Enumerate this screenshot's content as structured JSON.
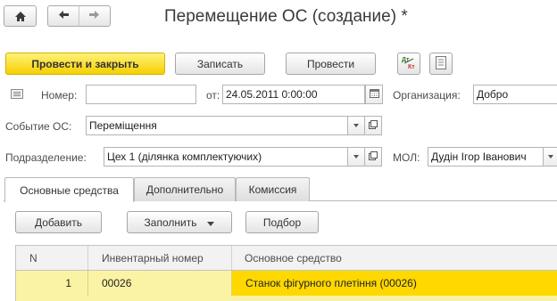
{
  "header": {
    "title": "Перемещение ОС (создание) *",
    "icons": {
      "home": "home-icon",
      "back": "arrow-left-icon",
      "forward": "arrow-right-icon"
    }
  },
  "toolbar": {
    "post_and_close": "Провести и закрыть",
    "save": "Записать",
    "post": "Провести",
    "icons": [
      "dt-kt-icon",
      "document-report-icon"
    ],
    "colors": {
      "primary": "#f6d000"
    }
  },
  "form": {
    "number_label": "Номер:",
    "number_value": "",
    "date_label": "от:",
    "date_value": "24.05.2011  0:00:00",
    "org_label": "Организация:",
    "org_value": "Добро",
    "event_label": "Событие ОС:",
    "event_value": "Переміщення",
    "division_label": "Подразделение:",
    "division_value": "Цех 1 (ділянка комплектуючих)",
    "mol_label": "МОЛ:",
    "mol_value": "Дудін Ігор Іванович"
  },
  "tabs": [
    {
      "label": "Основные средства",
      "active": true
    },
    {
      "label": "Дополнительно",
      "active": false
    },
    {
      "label": "Комиссия",
      "active": false
    }
  ],
  "table_toolbar": {
    "add": "Добавить",
    "fill": "Заполнить",
    "select": "Подбор"
  },
  "table": {
    "columns": [
      "N",
      "Инвентарный номер",
      "Основное средство"
    ],
    "rows": [
      {
        "n": "1",
        "inventory": "00026",
        "asset": "Станок фігурного плетіння (00026)"
      }
    ],
    "colors": {
      "row_selected": "#fbf3a4",
      "cell_selected": "#ffd800"
    }
  }
}
